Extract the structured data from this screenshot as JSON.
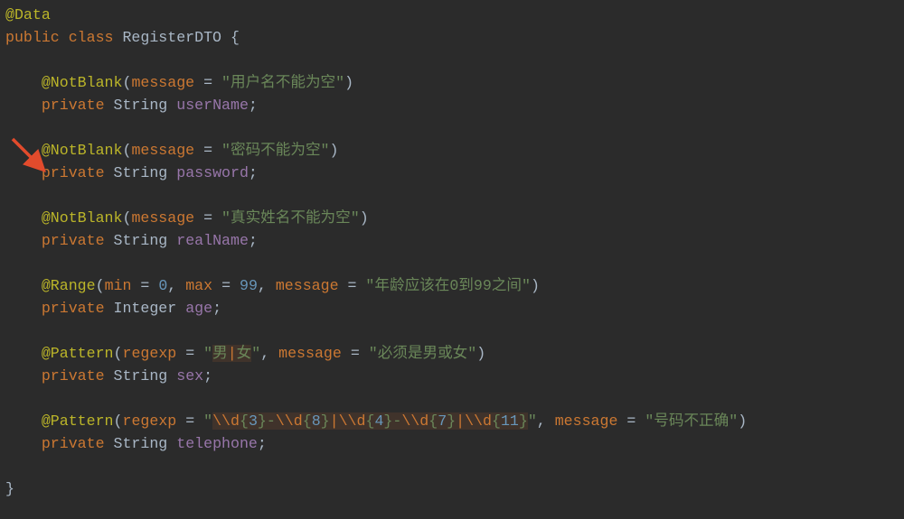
{
  "line1": {
    "ann": "@Data"
  },
  "line2": {
    "kw1": "public ",
    "kw2": "class ",
    "cls": "RegisterDTO ",
    "brace": "{"
  },
  "blk1": {
    "ann": "@NotBlank",
    "paramLbl": "message ",
    "eq": "= ",
    "str": "\"用户名不能为空\"",
    "pri": "private ",
    "typ": "String ",
    "fld": "userName",
    "semi": ";"
  },
  "blk2": {
    "ann": "@NotBlank",
    "paramLbl": "message ",
    "eq": "= ",
    "str": "\"密码不能为空\"",
    "pri": "private ",
    "typ": "String ",
    "fld": "password",
    "semi": ";"
  },
  "blk3": {
    "ann": "@NotBlank",
    "paramLbl": "message ",
    "eq": "= ",
    "str": "\"真实姓名不能为空\"",
    "pri": "private ",
    "typ": "String ",
    "fld": "realName",
    "semi": ";"
  },
  "blk4": {
    "ann": "@Range",
    "minLbl": "min ",
    "eq": "= ",
    "minVal": "0",
    "maxLbl": "max ",
    "maxVal": "99",
    "msgLbl": "message ",
    "str": "\"年龄应该在0到99之间\"",
    "pri": "private ",
    "typ": "Integer ",
    "fld": "age",
    "semi": ";"
  },
  "blk5": {
    "ann": "@Pattern",
    "reLbl": "regexp ",
    "eq": "= ",
    "rq": "\"",
    "r1": "男",
    "rpipe": "|",
    "r2": "女",
    "rq2": "\"",
    "msgLbl": "message ",
    "str": "\"必须是男或女\"",
    "pri": "private ",
    "typ": "String ",
    "fld": "sex",
    "semi": ";"
  },
  "blk6": {
    "ann": "@Pattern",
    "reLbl": "regexp ",
    "eq": "= ",
    "rq": "\"",
    "esc1": "\\\\d",
    "b1": "{",
    "n1": "3",
    "b2": "}",
    "dash1": "-",
    "esc2": "\\\\d",
    "b3": "{",
    "n2": "8",
    "b4": "}",
    "pipe1": "|",
    "esc3": "\\\\d",
    "b5": "{",
    "n3": "4",
    "b6": "}",
    "dash2": "-",
    "esc4": "\\\\d",
    "b7": "{",
    "n4": "7",
    "b8": "}",
    "pipe2": "|",
    "esc5": "\\\\d",
    "b9": "{",
    "n5": "11",
    "b10": "}",
    "rq2": "\"",
    "msgLbl": "message ",
    "str": "\"号码不正确\"",
    "pri": "private ",
    "typ": "String ",
    "fld": "telephone",
    "semi": ";"
  },
  "close": {
    "brace": "}"
  },
  "indent": "    ",
  "comma": ", ",
  "lpar": "(",
  "rpar": ")"
}
